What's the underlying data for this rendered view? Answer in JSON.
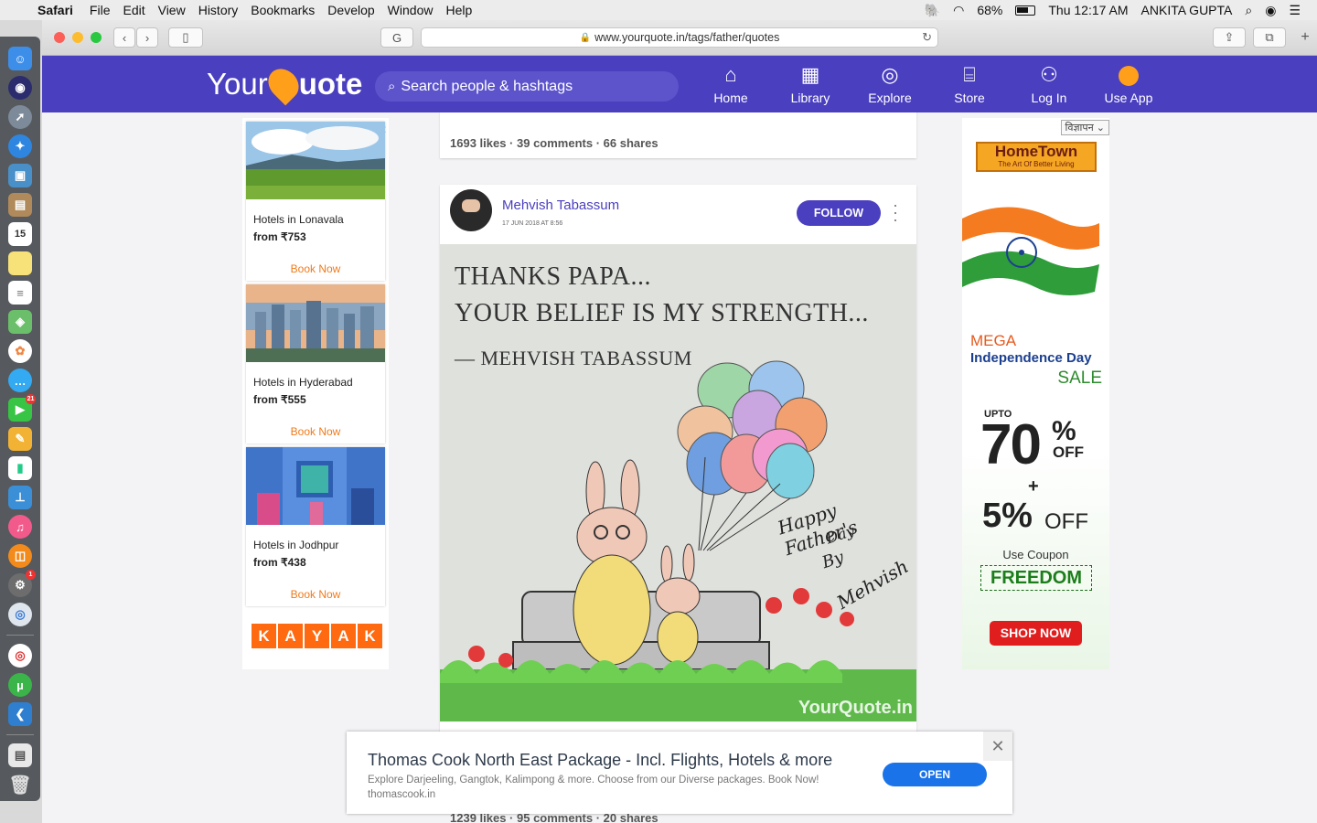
{
  "menubar": {
    "app": "Safari",
    "items": [
      "File",
      "Edit",
      "View",
      "History",
      "Bookmarks",
      "Develop",
      "Window",
      "Help"
    ],
    "battery": "68%",
    "clock": "Thu 12:17 AM",
    "user": "ANKITA GUPTA"
  },
  "browser": {
    "url": "www.yourquote.in/tags/father/quotes"
  },
  "site": {
    "logo_left": "Your",
    "logo_right": "uote",
    "search_placeholder": "Search people & hashtags",
    "nav": [
      {
        "label": "Home",
        "icon": "home-icon"
      },
      {
        "label": "Library",
        "icon": "library-icon"
      },
      {
        "label": "Explore",
        "icon": "compass-icon"
      },
      {
        "label": "Store",
        "icon": "store-icon"
      },
      {
        "label": "Log In",
        "icon": "user-icon"
      },
      {
        "label": "Use App",
        "icon": "app-icon"
      }
    ]
  },
  "left_ad": {
    "hotels": [
      {
        "name": "Hotels in Lonavala",
        "price": "from ₹753",
        "cta": "Book Now"
      },
      {
        "name": "Hotels in Hyderabad",
        "price": "from ₹555",
        "cta": "Book Now"
      },
      {
        "name": "Hotels in Jodhpur",
        "price": "from ₹438",
        "cta": "Book Now"
      }
    ],
    "brand": [
      "K",
      "A",
      "Y",
      "A",
      "K"
    ]
  },
  "feed": {
    "post1_stats": "1693 likes · 39 comments · 66 shares",
    "post2": {
      "author": "Mehvish Tabassum",
      "date": "17 JUN 2018 AT 8:56",
      "follow": "FOLLOW",
      "quote_line1": "THANKS PAPA...",
      "quote_line2": "YOUR BELIEF IS MY STRENGTH...",
      "quote_sig": "— MEHVISH TABASSUM",
      "hand_line1": "Happy Father's",
      "hand_line2": "Day",
      "hand_line3": "By",
      "hand_line4": "Mehvish",
      "watermark": "YourQuote.in"
    },
    "post3_stats": "1239 likes · 95 comments · 20 shares"
  },
  "right_ad": {
    "label": "विज्ञापन",
    "brand": "HomeTown",
    "tagline": "The Art Of Better Living",
    "mega": "MEGA",
    "event": "Independence Day",
    "sale": "SALE",
    "upto": "UPTO",
    "discount": "70",
    "percent": "%",
    "off": "OFF",
    "plus": "+",
    "extra": "5%",
    "extra_off": "OFF",
    "use_coupon": "Use Coupon",
    "coupon": "FREEDOM",
    "cta": "SHOP NOW"
  },
  "bottom_ad": {
    "title": "Thomas Cook North East Package - Incl. Flights, Hotels & more",
    "desc": "Explore Darjeeling, Gangtok, Kalimpong & more. Choose from our Diverse packages. Book Now!",
    "domain": "thomascook.in",
    "cta": "OPEN"
  },
  "colors": {
    "brand": "#4a3fbf",
    "accent": "#ff9f1a"
  }
}
